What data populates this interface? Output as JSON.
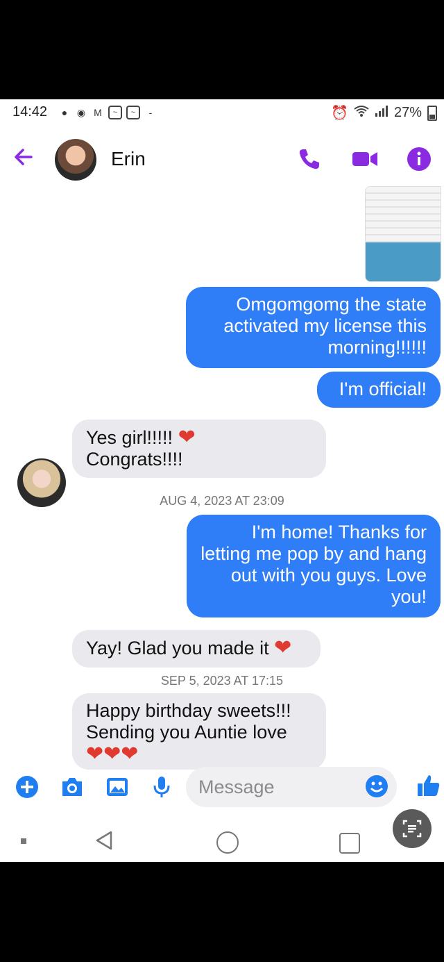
{
  "status": {
    "time": "14:42",
    "battery": "27%",
    "icons": [
      "message-icon",
      "messenger-icon",
      "gmail-icon",
      "app-icon",
      "app-icon",
      "dash-icon",
      "alarm-icon",
      "wifi-icon",
      "signal-icon",
      "battery-icon"
    ]
  },
  "header": {
    "contact_name": "Erin"
  },
  "messages": [
    {
      "type": "outgoing",
      "text": "Omgomgomg the state activated my license this morning!!!!!!"
    },
    {
      "type": "outgoing",
      "text": "I'm official!"
    },
    {
      "type": "incoming",
      "text_line1": "Yes girl!!!!!",
      "text_line2": "Congrats!!!!"
    },
    {
      "type": "timestamp",
      "text": "AUG 4, 2023 AT 23:09"
    },
    {
      "type": "outgoing",
      "text": "I'm home! Thanks for letting me pop by and hang out with you guys. Love you!"
    },
    {
      "type": "incoming",
      "text": "Yay! Glad you made it"
    },
    {
      "type": "timestamp",
      "text": "SEP 5, 2023 AT 17:15"
    },
    {
      "type": "incoming",
      "text_line1": "Happy birthday sweets!!!",
      "text_line2": "Sending you Auntie love"
    }
  ],
  "composer": {
    "placeholder": "Message"
  },
  "colors": {
    "accent": "#8a2be2",
    "outgoing_bubble": "#2f7ef7",
    "incoming_bubble": "#e9e9ee",
    "heart": "#e0392f"
  }
}
